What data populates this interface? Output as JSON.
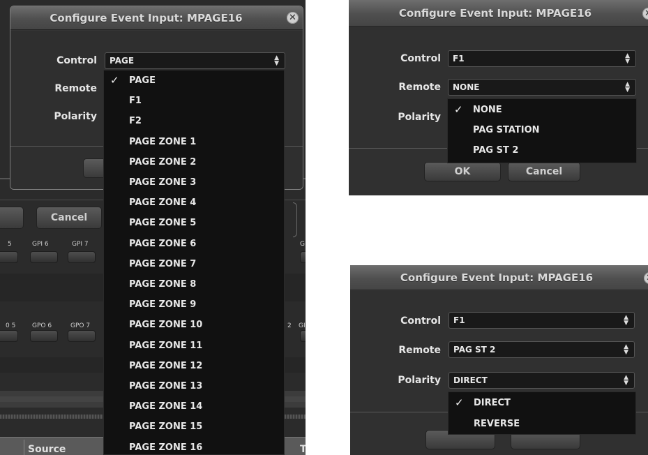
{
  "panel_left": {
    "dialog_title": "Configure Event Input: MPAGE16",
    "close_icon": "close-icon",
    "fields": [
      {
        "label": "Control",
        "value": "PAGE"
      },
      {
        "label": "Remote"
      },
      {
        "label": "Polarity"
      }
    ],
    "cancel_label": "Cancel",
    "gpi_labels": [
      "5",
      "GPI 6",
      "GPI 7",
      "G"
    ],
    "gpo_labels": [
      "0 5",
      "GPO 6",
      "GPO 7",
      "2",
      "GI"
    ],
    "source_label": "Source",
    "right_edge_label": "T",
    "dropdown": {
      "selected_index": 0,
      "check_icon": "checkmark-icon",
      "items": [
        "PAGE",
        "F1",
        "F2",
        "PAGE ZONE 1",
        "PAGE ZONE 2",
        "PAGE ZONE 3",
        "PAGE ZONE 4",
        "PAGE ZONE 5",
        "PAGE ZONE 6",
        "PAGE ZONE 7",
        "PAGE ZONE 8",
        "PAGE ZONE 9",
        "PAGE ZONE 10",
        "PAGE ZONE 11",
        "PAGE ZONE 12",
        "PAGE ZONE 13",
        "PAGE ZONE 14",
        "PAGE ZONE 15",
        "PAGE ZONE 16"
      ]
    }
  },
  "panel_top_right": {
    "dialog_title": "Configure Event Input: MPAGE16",
    "fields": [
      {
        "label": "Control",
        "value": "F1"
      },
      {
        "label": "Remote",
        "value": "NONE"
      },
      {
        "label": "Polarity"
      }
    ],
    "ok_label": "OK",
    "cancel_label": "Cancel",
    "dropdown": {
      "selected_index": 0,
      "items": [
        "NONE",
        "PAG STATION",
        "PAG ST 2"
      ]
    }
  },
  "panel_bottom_right": {
    "dialog_title": "Configure Event Input: MPAGE16",
    "fields": [
      {
        "label": "Control",
        "value": "F1"
      },
      {
        "label": "Remote",
        "value": "PAG ST 2"
      },
      {
        "label": "Polarity",
        "value": "DIRECT"
      }
    ],
    "dropdown": {
      "selected_index": 0,
      "items": [
        "DIRECT",
        "REVERSE"
      ]
    }
  },
  "colors": {
    "background": "#2e2e2e",
    "dropdown_bg": "#111111",
    "text": "#e8e8e8"
  }
}
